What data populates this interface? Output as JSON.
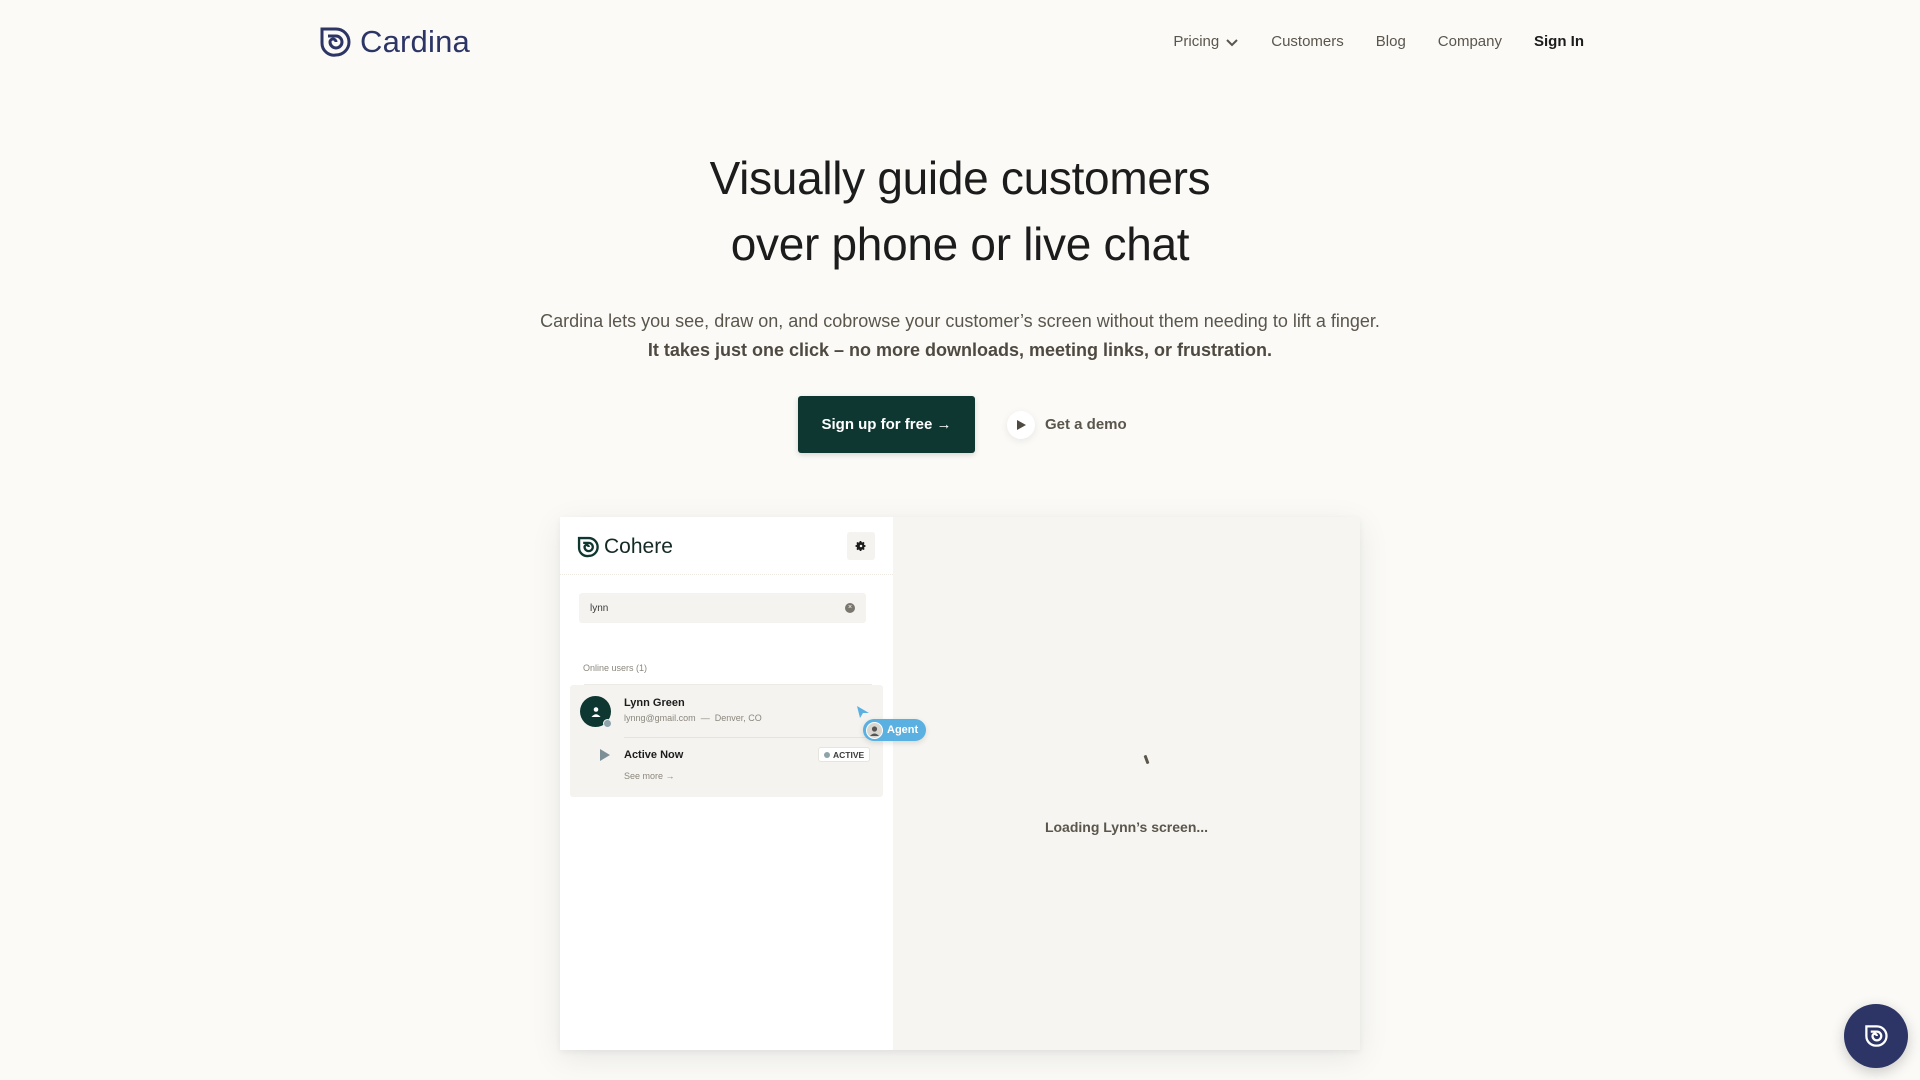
{
  "header": {
    "brand": "Cardina",
    "nav": [
      {
        "label": "Pricing",
        "has_dropdown": true
      },
      {
        "label": "Customers"
      },
      {
        "label": "Blog"
      },
      {
        "label": "Company"
      },
      {
        "label": "Sign In"
      }
    ]
  },
  "hero": {
    "title_line1": "Visually guide customers",
    "title_line2": "over phone or live chat",
    "subtitle": "Cardina lets you see, draw on, and cobrowse your customer’s screen without them needing to lift a finger.",
    "subtitle_bold": "It takes just one click – no more downloads, meeting links, or frustration.",
    "primary_cta": "Sign up for free →",
    "secondary_cta": "Get a demo"
  },
  "mockup": {
    "app_name": "Cohere",
    "search_value": "lynn",
    "online_label": "Online users (1)",
    "user": {
      "name": "Lynn Green",
      "email": "lynng@gmail.com",
      "separator": "—",
      "location": "Denver, CO",
      "session_label": "Active Now",
      "status_badge": "ACTIVE",
      "see_more": "See more →"
    },
    "agent_label": "Agent",
    "loading_text": "Loading Lynn’s screen..."
  },
  "colors": {
    "brand_navy": "#2c3566",
    "cta_green": "#0e3731",
    "agent_blue": "#5ab0e0",
    "background": "#fbfaf7"
  }
}
